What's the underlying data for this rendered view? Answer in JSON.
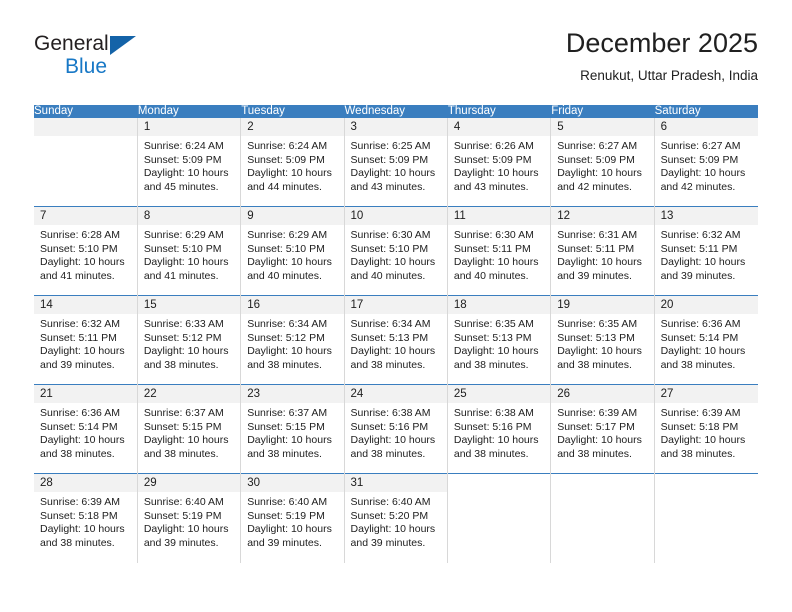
{
  "brand": {
    "name_top": "General",
    "name_bottom": "Blue",
    "triangle_color": "#1463a8",
    "blue_color": "#1878c6"
  },
  "header": {
    "title": "December 2025",
    "subtitle": "Renukut, Uttar Pradesh, India"
  },
  "theme": {
    "header_blue": "#3a7ebf",
    "daynum_band": "#f2f2f2",
    "cell_border": "#d8d8d8"
  },
  "weekday_headers": [
    "Sunday",
    "Monday",
    "Tuesday",
    "Wednesday",
    "Thursday",
    "Friday",
    "Saturday"
  ],
  "labels": {
    "sunrise_prefix": "Sunrise: ",
    "sunset_prefix": "Sunset: ",
    "daylight_prefix": "Daylight: "
  },
  "weeks": [
    [
      {
        "empty": true
      },
      {
        "day": "1",
        "sunrise": "Sunrise: 6:24 AM",
        "sunset": "Sunset: 5:09 PM",
        "daylight": "Daylight: 10 hours and 45 minutes."
      },
      {
        "day": "2",
        "sunrise": "Sunrise: 6:24 AM",
        "sunset": "Sunset: 5:09 PM",
        "daylight": "Daylight: 10 hours and 44 minutes."
      },
      {
        "day": "3",
        "sunrise": "Sunrise: 6:25 AM",
        "sunset": "Sunset: 5:09 PM",
        "daylight": "Daylight: 10 hours and 43 minutes."
      },
      {
        "day": "4",
        "sunrise": "Sunrise: 6:26 AM",
        "sunset": "Sunset: 5:09 PM",
        "daylight": "Daylight: 10 hours and 43 minutes."
      },
      {
        "day": "5",
        "sunrise": "Sunrise: 6:27 AM",
        "sunset": "Sunset: 5:09 PM",
        "daylight": "Daylight: 10 hours and 42 minutes."
      },
      {
        "day": "6",
        "sunrise": "Sunrise: 6:27 AM",
        "sunset": "Sunset: 5:09 PM",
        "daylight": "Daylight: 10 hours and 42 minutes."
      }
    ],
    [
      {
        "day": "7",
        "sunrise": "Sunrise: 6:28 AM",
        "sunset": "Sunset: 5:10 PM",
        "daylight": "Daylight: 10 hours and 41 minutes."
      },
      {
        "day": "8",
        "sunrise": "Sunrise: 6:29 AM",
        "sunset": "Sunset: 5:10 PM",
        "daylight": "Daylight: 10 hours and 41 minutes."
      },
      {
        "day": "9",
        "sunrise": "Sunrise: 6:29 AM",
        "sunset": "Sunset: 5:10 PM",
        "daylight": "Daylight: 10 hours and 40 minutes."
      },
      {
        "day": "10",
        "sunrise": "Sunrise: 6:30 AM",
        "sunset": "Sunset: 5:10 PM",
        "daylight": "Daylight: 10 hours and 40 minutes."
      },
      {
        "day": "11",
        "sunrise": "Sunrise: 6:30 AM",
        "sunset": "Sunset: 5:11 PM",
        "daylight": "Daylight: 10 hours and 40 minutes."
      },
      {
        "day": "12",
        "sunrise": "Sunrise: 6:31 AM",
        "sunset": "Sunset: 5:11 PM",
        "daylight": "Daylight: 10 hours and 39 minutes."
      },
      {
        "day": "13",
        "sunrise": "Sunrise: 6:32 AM",
        "sunset": "Sunset: 5:11 PM",
        "daylight": "Daylight: 10 hours and 39 minutes."
      }
    ],
    [
      {
        "day": "14",
        "sunrise": "Sunrise: 6:32 AM",
        "sunset": "Sunset: 5:11 PM",
        "daylight": "Daylight: 10 hours and 39 minutes."
      },
      {
        "day": "15",
        "sunrise": "Sunrise: 6:33 AM",
        "sunset": "Sunset: 5:12 PM",
        "daylight": "Daylight: 10 hours and 38 minutes."
      },
      {
        "day": "16",
        "sunrise": "Sunrise: 6:34 AM",
        "sunset": "Sunset: 5:12 PM",
        "daylight": "Daylight: 10 hours and 38 minutes."
      },
      {
        "day": "17",
        "sunrise": "Sunrise: 6:34 AM",
        "sunset": "Sunset: 5:13 PM",
        "daylight": "Daylight: 10 hours and 38 minutes."
      },
      {
        "day": "18",
        "sunrise": "Sunrise: 6:35 AM",
        "sunset": "Sunset: 5:13 PM",
        "daylight": "Daylight: 10 hours and 38 minutes."
      },
      {
        "day": "19",
        "sunrise": "Sunrise: 6:35 AM",
        "sunset": "Sunset: 5:13 PM",
        "daylight": "Daylight: 10 hours and 38 minutes."
      },
      {
        "day": "20",
        "sunrise": "Sunrise: 6:36 AM",
        "sunset": "Sunset: 5:14 PM",
        "daylight": "Daylight: 10 hours and 38 minutes."
      }
    ],
    [
      {
        "day": "21",
        "sunrise": "Sunrise: 6:36 AM",
        "sunset": "Sunset: 5:14 PM",
        "daylight": "Daylight: 10 hours and 38 minutes."
      },
      {
        "day": "22",
        "sunrise": "Sunrise: 6:37 AM",
        "sunset": "Sunset: 5:15 PM",
        "daylight": "Daylight: 10 hours and 38 minutes."
      },
      {
        "day": "23",
        "sunrise": "Sunrise: 6:37 AM",
        "sunset": "Sunset: 5:15 PM",
        "daylight": "Daylight: 10 hours and 38 minutes."
      },
      {
        "day": "24",
        "sunrise": "Sunrise: 6:38 AM",
        "sunset": "Sunset: 5:16 PM",
        "daylight": "Daylight: 10 hours and 38 minutes."
      },
      {
        "day": "25",
        "sunrise": "Sunrise: 6:38 AM",
        "sunset": "Sunset: 5:16 PM",
        "daylight": "Daylight: 10 hours and 38 minutes."
      },
      {
        "day": "26",
        "sunrise": "Sunrise: 6:39 AM",
        "sunset": "Sunset: 5:17 PM",
        "daylight": "Daylight: 10 hours and 38 minutes."
      },
      {
        "day": "27",
        "sunrise": "Sunrise: 6:39 AM",
        "sunset": "Sunset: 5:18 PM",
        "daylight": "Daylight: 10 hours and 38 minutes."
      }
    ],
    [
      {
        "day": "28",
        "sunrise": "Sunrise: 6:39 AM",
        "sunset": "Sunset: 5:18 PM",
        "daylight": "Daylight: 10 hours and 38 minutes."
      },
      {
        "day": "29",
        "sunrise": "Sunrise: 6:40 AM",
        "sunset": "Sunset: 5:19 PM",
        "daylight": "Daylight: 10 hours and 39 minutes."
      },
      {
        "day": "30",
        "sunrise": "Sunrise: 6:40 AM",
        "sunset": "Sunset: 5:19 PM",
        "daylight": "Daylight: 10 hours and 39 minutes."
      },
      {
        "day": "31",
        "sunrise": "Sunrise: 6:40 AM",
        "sunset": "Sunset: 5:20 PM",
        "daylight": "Daylight: 10 hours and 39 minutes."
      },
      {
        "blank": true
      },
      {
        "blank": true
      },
      {
        "blank": true
      }
    ]
  ]
}
